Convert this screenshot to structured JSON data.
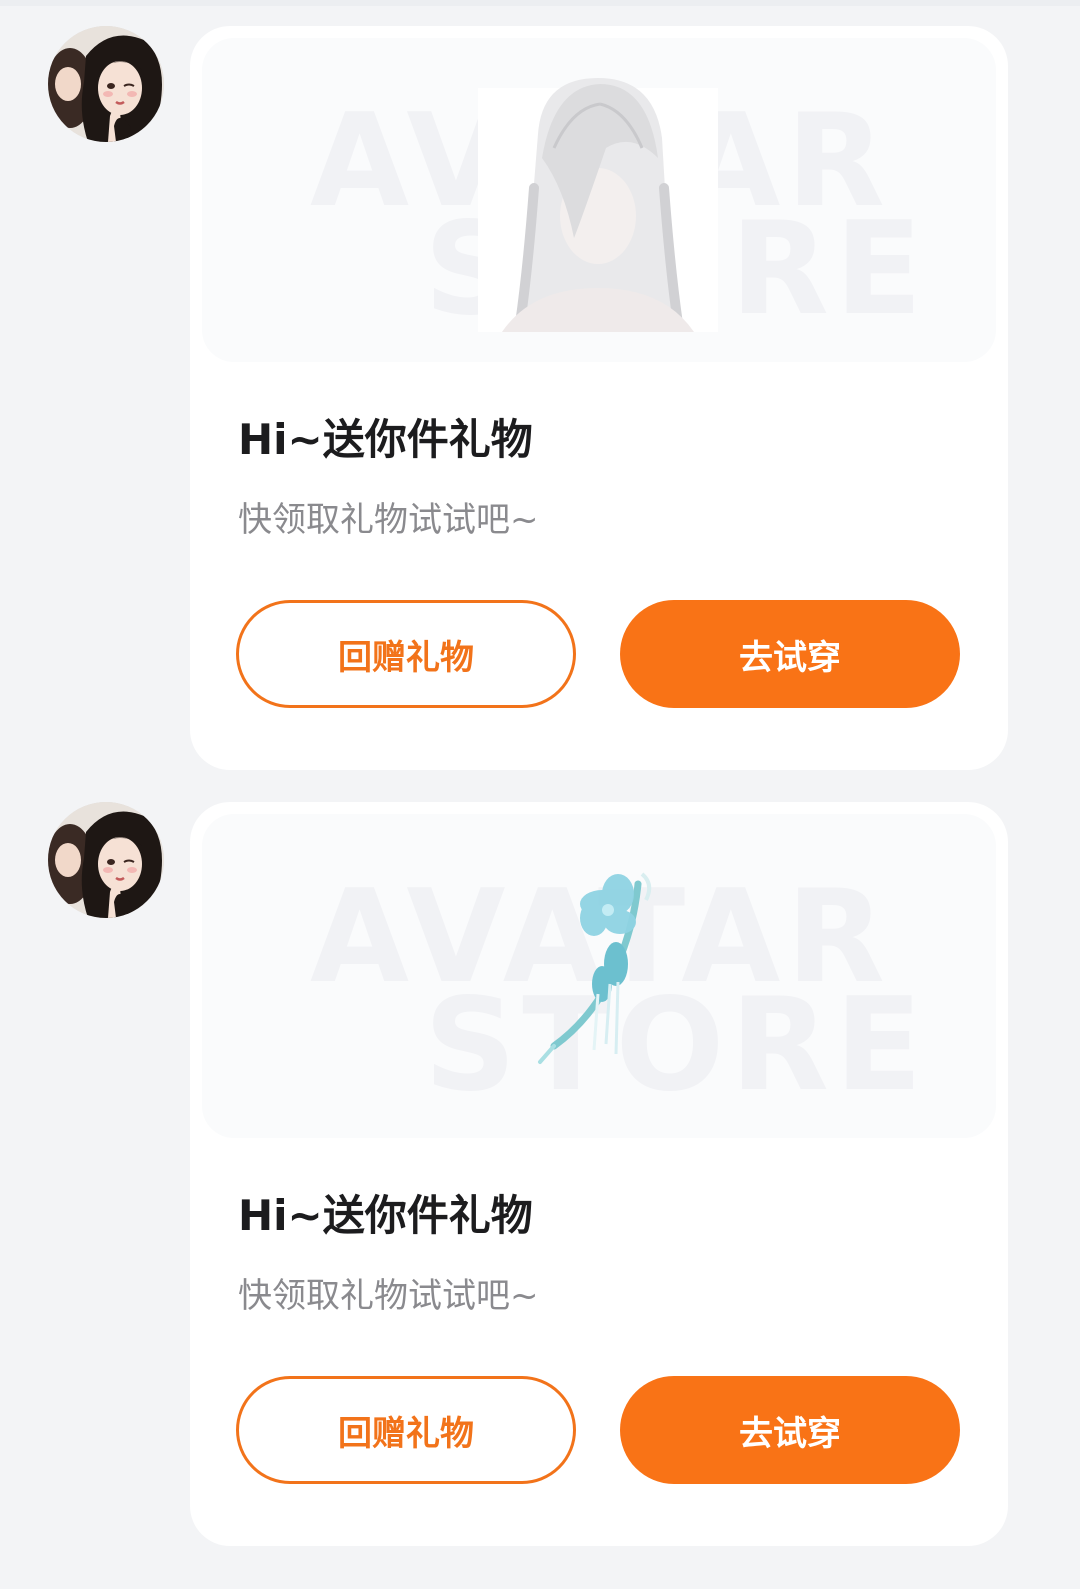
{
  "messages": [
    {
      "sender_avatar": "avatar-girl-winking",
      "preview": {
        "watermark_line1": "AVATAR",
        "watermark_line2": "STORE",
        "item_icon": "white-long-hair-wig"
      },
      "title": "Hi~送你件礼物",
      "subtitle": "快领取礼物试试吧~",
      "return_gift_label": "回赠礼物",
      "try_on_label": "去试穿"
    },
    {
      "sender_avatar": "avatar-girl-winking",
      "preview": {
        "watermark_line1": "AVATAR",
        "watermark_line2": "STORE",
        "item_icon": "blue-flower-hairpin"
      },
      "title": "Hi~送你件礼物",
      "subtitle": "快领取礼物试试吧~",
      "return_gift_label": "回赠礼物",
      "try_on_label": "去试穿"
    }
  ],
  "colors": {
    "accent": "#f97316",
    "outline_accent": "#f2731a",
    "page_bg": "#f3f4f6",
    "card_bg": "#ffffff"
  }
}
